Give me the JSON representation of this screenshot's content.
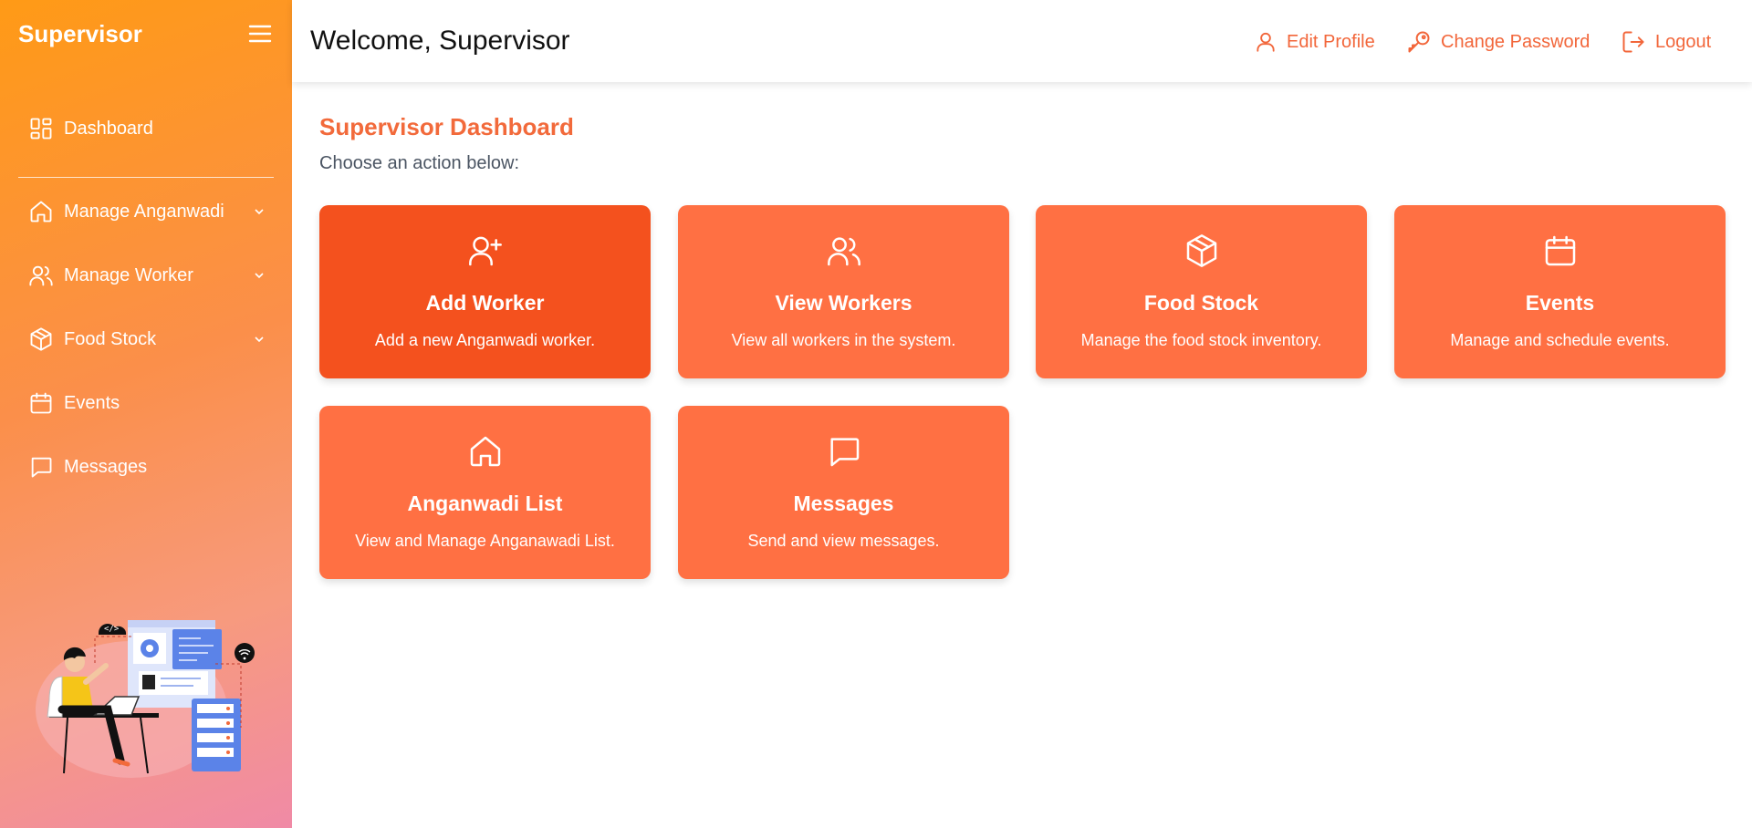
{
  "sidebar": {
    "brand": "Supervisor",
    "menu_icon": "hamburger-icon",
    "items": [
      {
        "label": "Dashboard",
        "icon": "dashboard-grid-icon"
      },
      {
        "label": "Manage Anganwadi",
        "icon": "home-icon",
        "has_submenu": true
      },
      {
        "label": "Manage Worker",
        "icon": "users-icon",
        "has_submenu": true
      },
      {
        "label": "Food Stock",
        "icon": "box-icon",
        "has_submenu": true
      },
      {
        "label": "Events",
        "icon": "calendar-icon"
      },
      {
        "label": "Messages",
        "icon": "message-icon"
      }
    ]
  },
  "header": {
    "welcome": "Welcome, Supervisor",
    "edit_profile": "Edit Profile",
    "change_password": "Change Password",
    "logout": "Logout"
  },
  "main": {
    "title": "Supervisor Dashboard",
    "subtitle": "Choose an action below:",
    "cards": [
      {
        "title": "Add Worker",
        "desc": "Add a new Anganwadi worker.",
        "icon": "user-plus-icon"
      },
      {
        "title": "View Workers",
        "desc": "View all workers in the system.",
        "icon": "users-icon"
      },
      {
        "title": "Food Stock",
        "desc": "Manage the food stock inventory.",
        "icon": "box-icon"
      },
      {
        "title": "Events",
        "desc": "Manage and schedule events.",
        "icon": "calendar-icon"
      },
      {
        "title": "Anganwadi List",
        "desc": "View and Manage Anganawadi List.",
        "icon": "home-icon"
      },
      {
        "title": "Messages",
        "desc": "Send and view messages.",
        "icon": "message-icon"
      }
    ]
  },
  "colors": {
    "accent": "#f26a3b",
    "card": "#ff7043",
    "card_active": "#f4511e",
    "sidebar_top": "#ff9a16",
    "sidebar_bottom": "#f08aa6"
  }
}
